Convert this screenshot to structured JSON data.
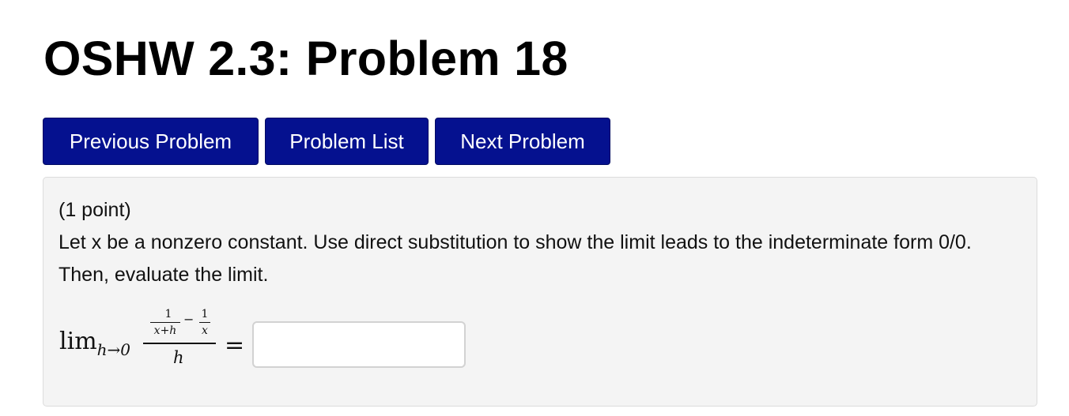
{
  "page": {
    "title": "OSHW 2.3: Problem 18"
  },
  "nav": {
    "previous_label": "Previous Problem",
    "list_label": "Problem List",
    "next_label": "Next Problem"
  },
  "problem": {
    "points": "(1 point)",
    "statement": "Let x be a nonzero constant. Use direct substitution to show the limit leads to the indeterminate form 0/0. Then, evaluate the limit.",
    "math": {
      "lim": "lim",
      "subscript": "h→0",
      "inner_num_1": "1",
      "inner_den_1": "x+h",
      "minus": "−",
      "inner_num_2": "1",
      "inner_den_2": "x",
      "outer_den": "h",
      "equals": "="
    },
    "answer": {
      "value": "",
      "placeholder": ""
    }
  },
  "colors": {
    "button_bg": "#05118f",
    "panel_bg": "#f4f4f4"
  }
}
